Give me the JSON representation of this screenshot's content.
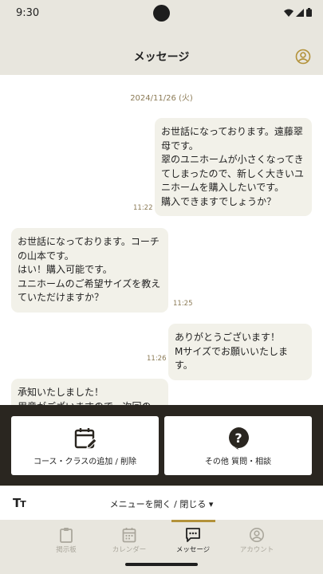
{
  "status_bar": {
    "time": "9:30"
  },
  "header": {
    "title": "メッセージ"
  },
  "chat": {
    "date": "2024/11/26 (火)",
    "messages": [
      {
        "side": "right",
        "text": "お世話になっております。遠藤翠\n母です。\n翠のユニホームが小さくなってき\nてしまったので、新しく大きいユ\nニホームを購入したいです。\n購入できますでしょうか？",
        "time": "11:22"
      },
      {
        "side": "left",
        "text": "お世話になっております。コーチ\nの山本です。\nはい！購入可能です。\nユニホームのご希望サイズを教え\nていただけますか？",
        "time": "11:25"
      },
      {
        "side": "right",
        "text": "ありがとうございます！\nMサイズでお願いいたします。",
        "time": "11:26"
      },
      {
        "side": "left",
        "text": "承知いたしました！\n用意がございますので、次回の",
        "time": ""
      }
    ]
  },
  "menu": {
    "buttons": [
      {
        "label": "コース・クラスの追加 / 削除",
        "icon": "calendar-edit-icon"
      },
      {
        "label": "その他 質問・相談",
        "icon": "question-bubble-icon"
      }
    ]
  },
  "toolbar": {
    "text_size_main": "T",
    "text_size_small": "T",
    "menu_toggle_label": "メニューを開く / 閉じる ▾"
  },
  "bottom_nav": {
    "items": [
      {
        "label": "掲示板",
        "icon": "clipboard-icon",
        "active": false
      },
      {
        "label": "カレンダー",
        "icon": "calendar-icon",
        "active": false
      },
      {
        "label": "メッセージ",
        "icon": "message-icon",
        "active": true
      },
      {
        "label": "アカウント",
        "icon": "account-icon",
        "active": false
      }
    ]
  },
  "colors": {
    "header_bg": "#e8e6de",
    "bubble_bg": "#f2f1e9",
    "accent": "#b3923a",
    "menu_panel_bg": "#2a2620"
  }
}
